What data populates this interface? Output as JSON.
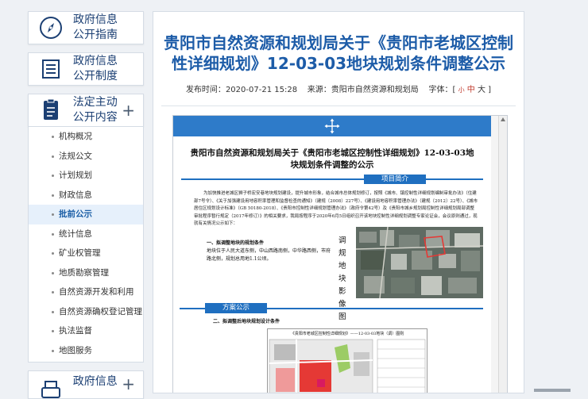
{
  "sidebar": {
    "cards": [
      {
        "label": "政府信息公开指南",
        "icon": "compass-icon"
      },
      {
        "label": "政府信息公开制度",
        "icon": "list-icon"
      },
      {
        "label": "法定主动公开内容",
        "icon": "document-icon",
        "expand": "+"
      },
      {
        "label": "政府信息",
        "icon": "printer-icon",
        "expand": "+"
      }
    ],
    "submenu": [
      "机构概况",
      "法规公文",
      "计划规划",
      "财政信息",
      "批前公示",
      "统计信息",
      "矿业权管理",
      "地质勘察管理",
      "自然资源开发和利用",
      "自然资源确权登记管理",
      "执法监督",
      "地图服务"
    ],
    "active_index": 4
  },
  "article": {
    "title": "贵阳市自然资源和规划局关于《贵阳市老城区控制性详细规划》12-03-03地块规划条件调整公示",
    "publish_label": "发布时间：",
    "publish_time": "2020-07-21 15:28",
    "source_label": "来源：",
    "source": "贵阳市自然资源和规划局",
    "font_label": "字体：[",
    "font_small": "小",
    "font_mid": "中",
    "font_large": "大",
    "font_end": "]"
  },
  "document": {
    "title": "贵阳市自然资源和规划局关于《贵阳市老城区控制性详细规划》12-03-03地块规划条件调整的公示",
    "section_intro": "项目简介",
    "intro_text": "为加快推进老城区狮子桥宏安巷地块规划建设，提升城市形象，结合城市总体规划修订，按照《城市、镇控制性详细规划编制审批办法》（住建部7号令）、《关于加强建设用地容积率管理和监督检查的通知》（建规〔2008〕227号）、《建设用地容积率管理办法》（建规〔2012〕22号）、《城市居住区规划设计标准》（GB 50180-2018）、《贵阳市控制性详细规划管理办法》（政府令第42号）及《贵阳市城乡规划局控制性详细规划局部调整审批程序暂行规定（2017年修订）》的相关要求，我局按程序于2020年6月5日组织召开该地块控制性详细规划调整专家论证会，会议原则通过，现就有关情况公示如下：",
    "item1_heading": "一、拟调整地块的规划条件",
    "item1_text": "地块位于人民大道东侧，中山西路南侧，中华路西侧，市府路北侧，规划总用地1.1公顷。",
    "vertical_label": "调规地块影像图",
    "section_plan": "方案公示",
    "item2_heading": "二、拟调整后地块规划设计条件",
    "map_caption": "《贵阳市老城区控制性详细规划》——12-03-03地块（调）图则"
  }
}
